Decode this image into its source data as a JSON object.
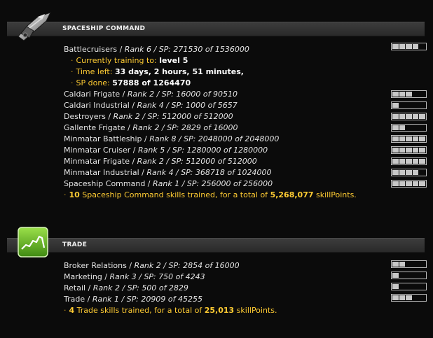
{
  "spaceship": {
    "title": "SPACESHIP COMMAND",
    "icon": "spaceship-icon",
    "skills": [
      {
        "name": "Battlecruisers",
        "detail": "Rank 6 / SP: 271530 of 1536000",
        "level": 4
      },
      {
        "name": "Caldari Frigate",
        "detail": "Rank 2 / SP: 16000 of 90510",
        "level": 3
      },
      {
        "name": "Caldari Industrial",
        "detail": "Rank 4 / SP: 1000 of 5657",
        "level": 1
      },
      {
        "name": "Destroyers",
        "detail": "Rank 2 / SP: 512000 of 512000",
        "level": 5
      },
      {
        "name": "Gallente Frigate",
        "detail": "Rank 2 / SP: 2829 of 16000",
        "level": 2
      },
      {
        "name": "Minmatar Battleship",
        "detail": "Rank 8 / SP: 2048000 of 2048000",
        "level": 5
      },
      {
        "name": "Minmatar Cruiser",
        "detail": "Rank 5 / SP: 1280000 of 1280000",
        "level": 5
      },
      {
        "name": "Minmatar Frigate",
        "detail": "Rank 2 / SP: 512000 of 512000",
        "level": 5
      },
      {
        "name": "Minmatar Industrial",
        "detail": "Rank 4 / SP: 368718 of 1024000",
        "level": 4
      },
      {
        "name": "Spaceship Command",
        "detail": "Rank 1 / SP: 256000 of 256000",
        "level": 5
      }
    ],
    "training": {
      "currently_label": "Currently training to:",
      "currently_value": "level 5",
      "time_label": "Time left:",
      "time_value": "33 days, 2 hours, 51 minutes,",
      "sp_label": "SP done:",
      "sp_value": "57888 of 1264470"
    },
    "summary": {
      "count": "10",
      "text1": "Spaceship Command skills trained, for a total of",
      "total": "5,268,077",
      "text2": "skillPoints."
    }
  },
  "trade": {
    "title": "TRADE",
    "icon": "trade-chart-icon",
    "skills": [
      {
        "name": "Broker Relations",
        "detail": "Rank 2 / SP: 2854 of 16000",
        "level": 2
      },
      {
        "name": "Marketing",
        "detail": "Rank 3 / SP: 750 of 4243",
        "level": 1
      },
      {
        "name": "Retail",
        "detail": "Rank 2 / SP: 500 of 2829",
        "level": 1
      },
      {
        "name": "Trade",
        "detail": "Rank 1 / SP: 20909 of 45255",
        "level": 3
      }
    ],
    "summary": {
      "count": "4",
      "text1": "Trade skills trained, for a total of",
      "total": "25,013",
      "text2": "skillPoints."
    }
  }
}
